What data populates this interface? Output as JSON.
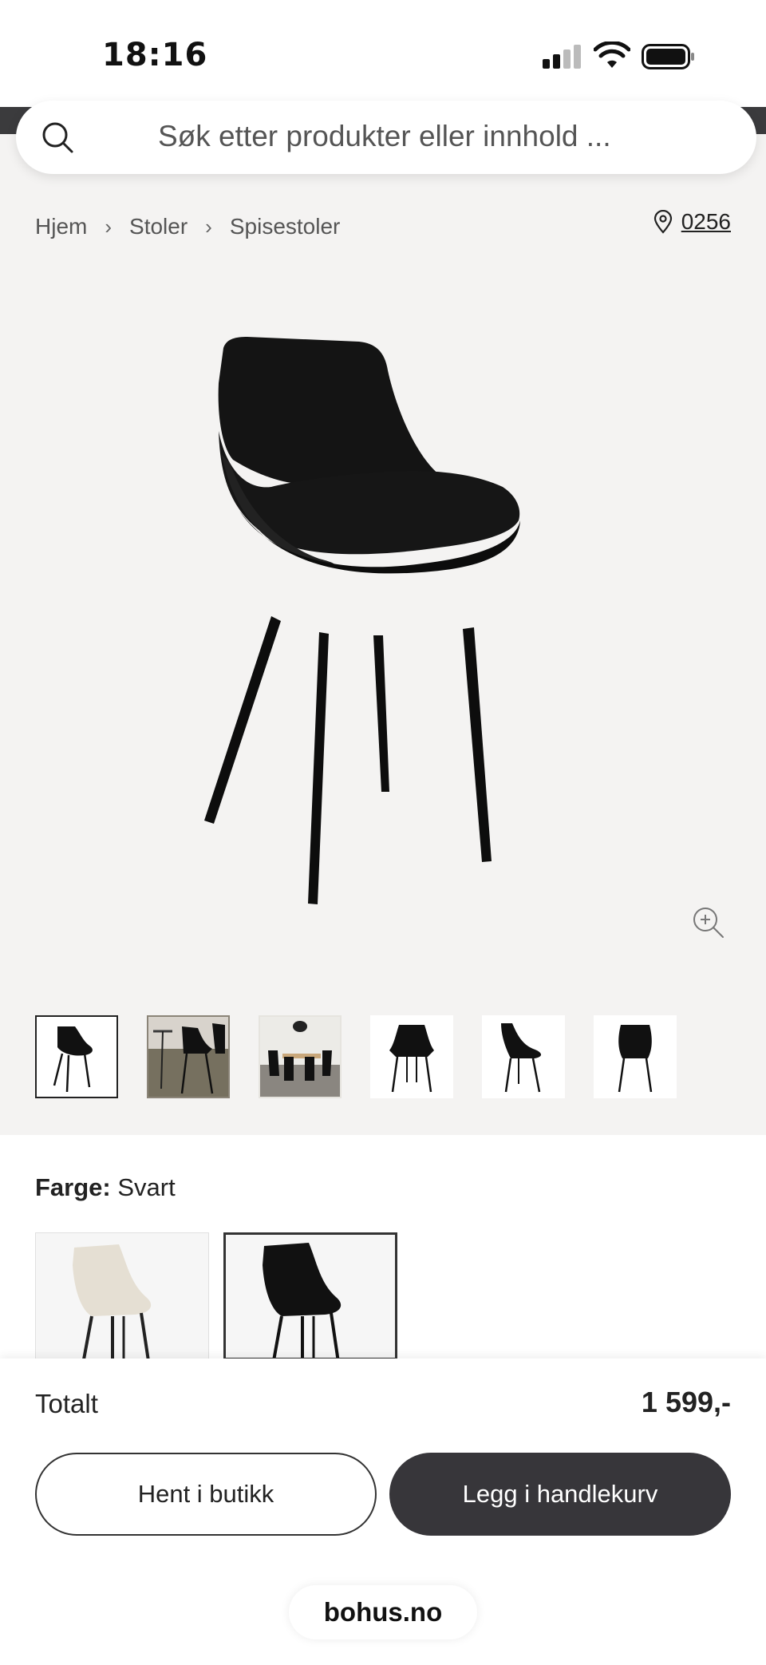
{
  "status_bar": {
    "time": "18:16"
  },
  "search": {
    "placeholder": "Søk etter produkter eller innhold ..."
  },
  "breadcrumb": {
    "items": [
      "Hjem",
      "Stoler",
      "Spisestoler"
    ]
  },
  "location": {
    "postcode": "0256"
  },
  "product": {
    "color_label": "Farge:",
    "color_value": "Svart",
    "thumbnail_count": 6,
    "selected_thumbnail": 0,
    "swatch_colors": [
      "#e8e2d8",
      "#111111"
    ],
    "selected_swatch": 1
  },
  "cart": {
    "total_label": "Totalt",
    "total_price": "1 599,-",
    "pickup_button": "Hent i butikk",
    "add_to_cart_button": "Legg i handlekurv"
  },
  "browser": {
    "url": "bohus.no"
  },
  "icons": [
    "search-icon",
    "chevron-right-icon",
    "location-pin-icon",
    "zoom-in-icon",
    "signal-icon",
    "wifi-icon",
    "battery-icon"
  ]
}
